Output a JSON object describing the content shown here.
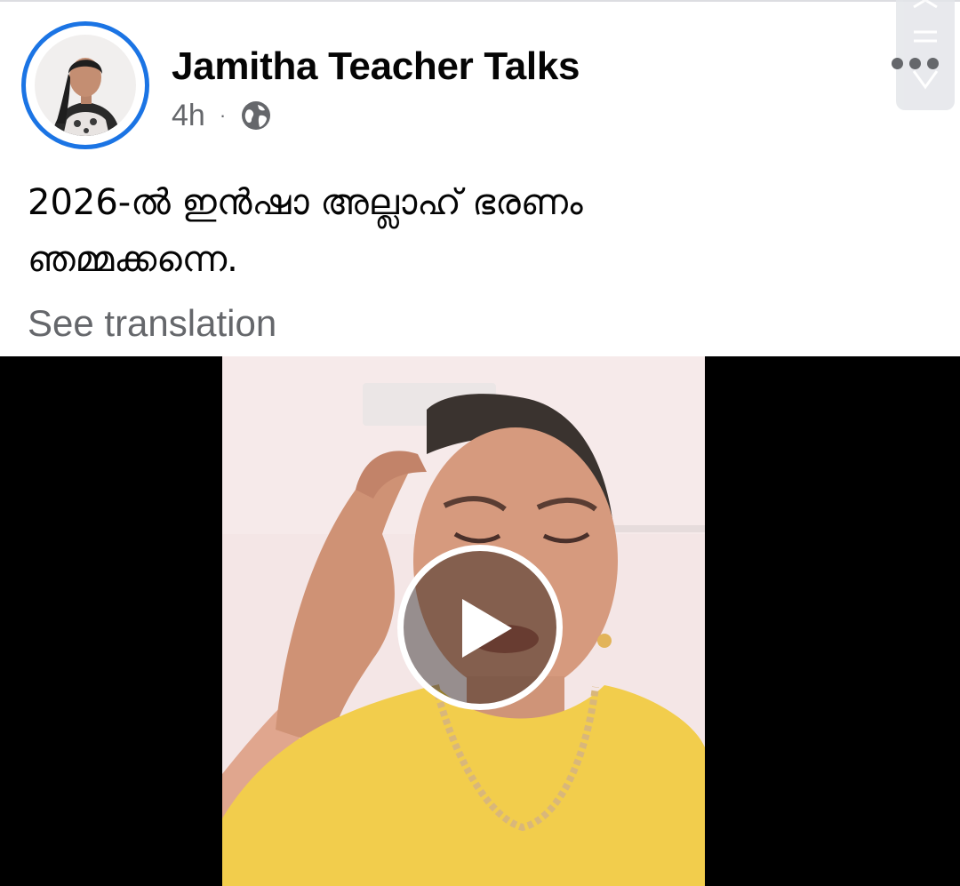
{
  "post": {
    "author_name": "Jamitha Teacher Talks",
    "timestamp": "4h",
    "separator": "·",
    "privacy_icon": "globe-icon",
    "more_icon": "more-options-icon",
    "text_lines": [
      "2026-ൽ ഇൻഷാ അല്ലാഹ് ഭരണം",
      "ഞമ്മക്കന്നെ."
    ],
    "translation_link": "See translation"
  },
  "video": {
    "play_icon": "play-icon"
  },
  "colors": {
    "accent_blue": "#1b74e4",
    "primary_text": "#050505",
    "secondary_text": "#65676b",
    "video_background": "#000000"
  }
}
